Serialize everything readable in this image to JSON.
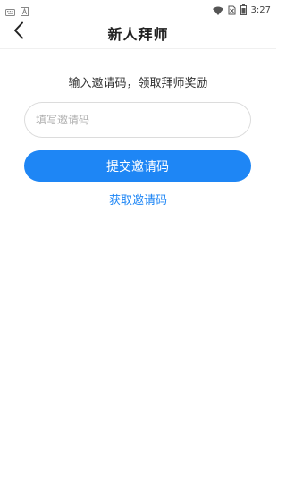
{
  "status_bar": {
    "time": "3:27",
    "icons": [
      "keyboard-icon",
      "text-a-icon",
      "wifi-icon",
      "no-sim-icon",
      "battery-icon"
    ]
  },
  "nav": {
    "title": "新人拜师",
    "back_icon": "chevron-left-icon"
  },
  "main": {
    "instruction": "输入邀请码，领取拜师奖励",
    "input_placeholder": "填写邀请码",
    "input_value": "",
    "submit_label": "提交邀请码",
    "get_code_label": "获取邀请码"
  },
  "colors": {
    "accent": "#1e86f5",
    "border": "#dcdcdc",
    "placeholder": "#b0b0b0"
  }
}
